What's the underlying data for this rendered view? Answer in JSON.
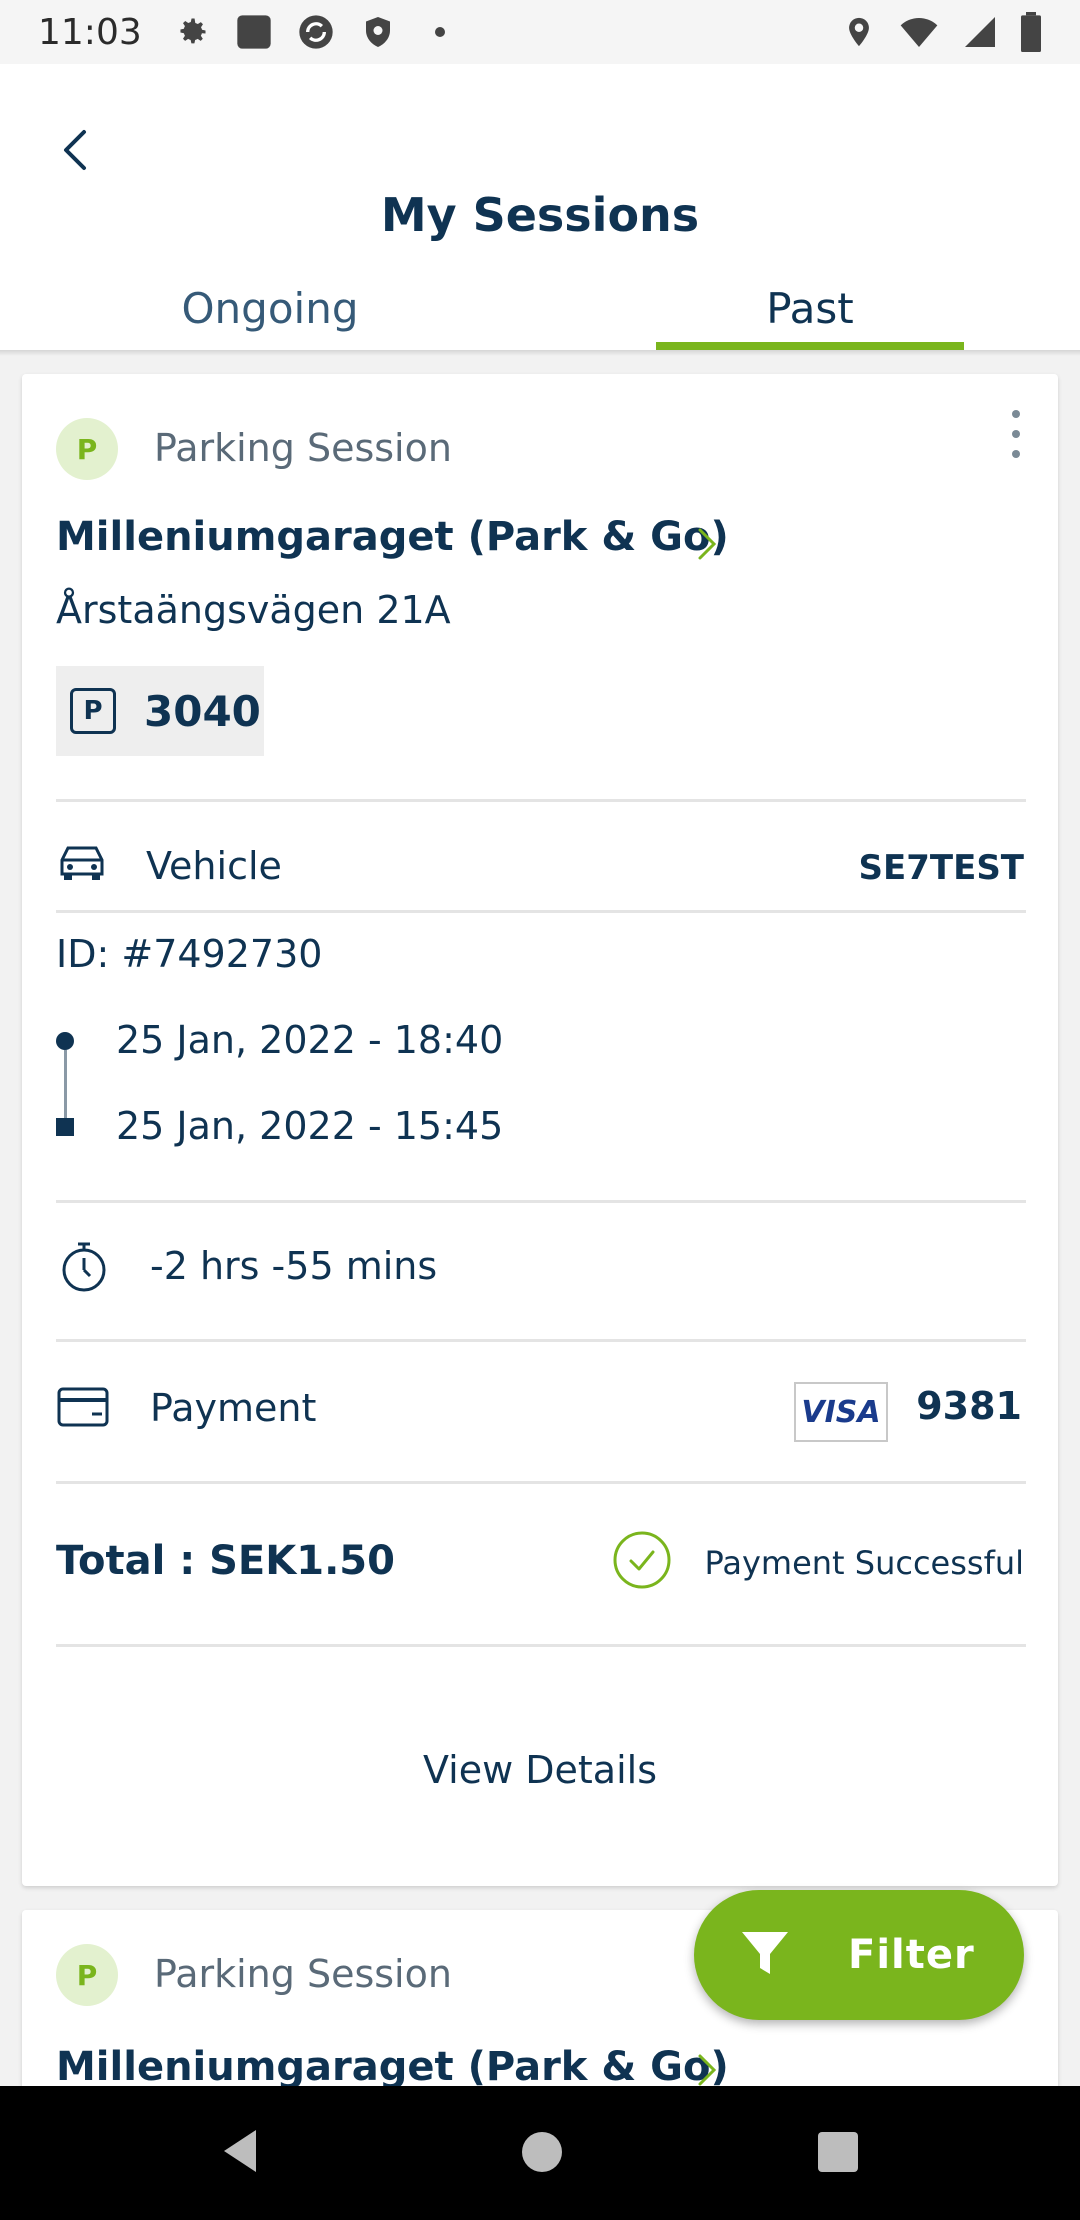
{
  "status_bar": {
    "time": "11:03",
    "left_icons": [
      "settings-icon",
      "app-icon",
      "sync-icon",
      "shield-icon",
      "dot-icon"
    ],
    "right_icons": [
      "location-icon",
      "wifi-icon",
      "signal-icon",
      "battery-icon"
    ]
  },
  "header": {
    "title": "My Sessions",
    "tabs": [
      {
        "label": "Ongoing",
        "active": false
      },
      {
        "label": "Past",
        "active": true
      }
    ]
  },
  "sessions": [
    {
      "badge": "P",
      "type": "Parking Session",
      "garage": "Milleniumgaraget (Park & Go)",
      "address": "Årstaängsvägen 21A",
      "spot_icon": "P",
      "spot_number": "3040",
      "vehicle_label": "Vehicle",
      "vehicle_plate": "SE7TEST",
      "id": "ID: #7492730",
      "time_start": "25 Jan, 2022 - 18:40",
      "time_end": "25 Jan, 2022 - 15:45",
      "duration": "-2 hrs -55 mins",
      "payment_label": "Payment",
      "card_brand": "VISA",
      "card_last4": "9381",
      "total": "Total : SEK1.50",
      "payment_status": "Payment Successful",
      "view_details": "View Details"
    },
    {
      "badge": "P",
      "type": "Parking Session",
      "garage": "Milleniumgaraget (Park & Go)"
    }
  ],
  "filter_button": {
    "label": "Filter"
  },
  "colors": {
    "accent": "#7ab51d",
    "primary_text": "#0f3352",
    "background": "#f2f2f2"
  }
}
